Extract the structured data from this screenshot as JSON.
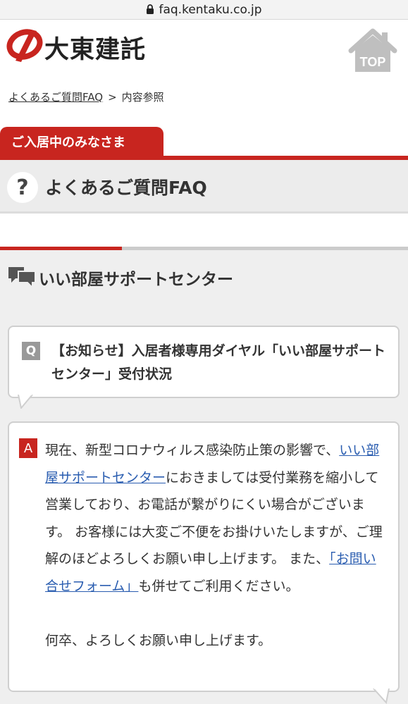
{
  "browser": {
    "url": "faq.kentaku.co.jp"
  },
  "header": {
    "logo_text": "大東建託",
    "top_label": "TOP"
  },
  "breadcrumb": {
    "home": "よくあるご質問FAQ",
    "separator": ">",
    "current": "内容参照"
  },
  "category": {
    "label": "ご入居中のみなさま"
  },
  "faq": {
    "icon_glyph": "?",
    "title": "よくあるご質問FAQ"
  },
  "section": {
    "title": "いい部屋サポートセンター"
  },
  "question": {
    "badge": "Q",
    "text": "【お知らせ】入居者様専用ダイヤル「いい部屋サポートセンター」受付状況"
  },
  "answer": {
    "badge": "A",
    "part1": "現在、新型コロナウィルス感染防止策の影響で、",
    "link1": "いい部屋サポートセンター",
    "part2": "におきましては受付業務を縮小して営業しており、お電話が繋がりにくい場合がございます。 お客様には大変ご不便をお掛けいたしますが、ご理解のほどよろしくお願い申し上げます。 また、",
    "link2": "「お問い合せフォーム」",
    "part3": "も併せてご利用ください。",
    "closing": "何卒、よろしくお願い申し上げます。"
  },
  "colors": {
    "brand_red": "#c8251f",
    "link_blue": "#2a5db0",
    "panel_grey": "#efefef"
  }
}
